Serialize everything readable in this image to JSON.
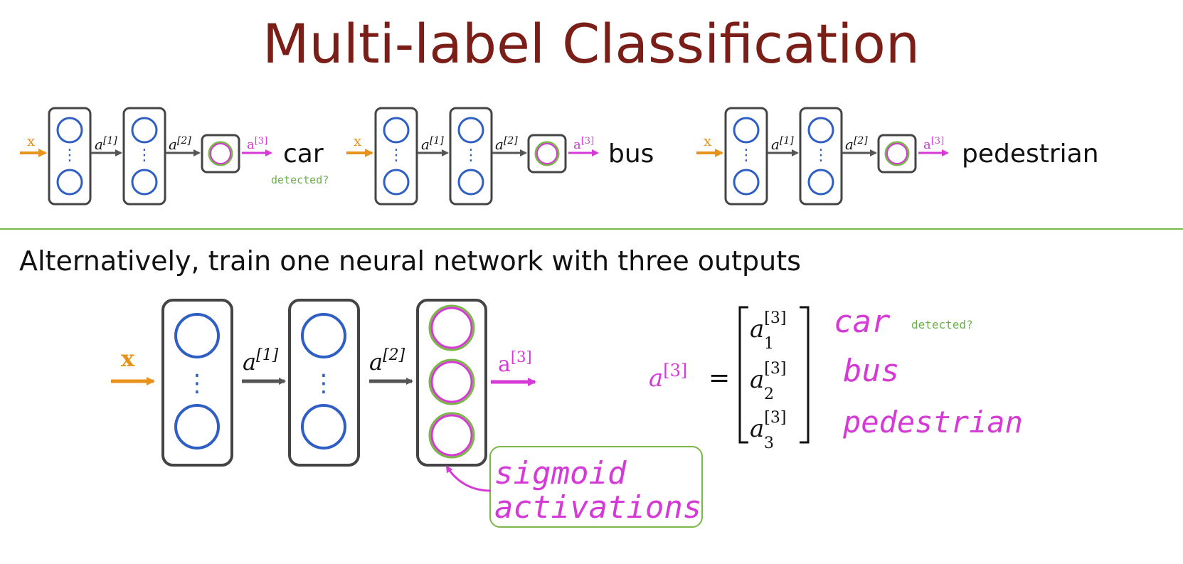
{
  "title": "Multi-label Classification",
  "colors": {
    "title": "#7b1e17",
    "neuron": "#2f5fc4",
    "input": "#e8921e",
    "output": "#d63ad6",
    "divider": "#7ab648",
    "hint": "#6ab04c",
    "box": "#444444"
  },
  "small_networks": [
    {
      "output_label": "car",
      "note": "detected?"
    },
    {
      "output_label": "bus",
      "note": ""
    },
    {
      "output_label": "pedestrian",
      "note": ""
    }
  ],
  "net_labels": {
    "input": "x",
    "a": "a",
    "a1_sup": "[1]",
    "a2_sup": "[2]",
    "a3_sup": "[3]"
  },
  "subtitle": "Alternatively, train one neural network with three outputs",
  "equation": {
    "lhs": "a",
    "lhs_sup": "[3]",
    "equals": "=",
    "entries": [
      {
        "sym": "a",
        "sub": "1",
        "sup": "[3]"
      },
      {
        "sym": "a",
        "sub": "2",
        "sup": "[3]"
      },
      {
        "sym": "a",
        "sub": "3",
        "sup": "[3]"
      }
    ]
  },
  "handwritten_labels": [
    "car",
    "bus",
    "pedestrian"
  ],
  "handwritten_note": "detected?",
  "annotation": {
    "line1": "sigmoid",
    "line2": "activations"
  }
}
